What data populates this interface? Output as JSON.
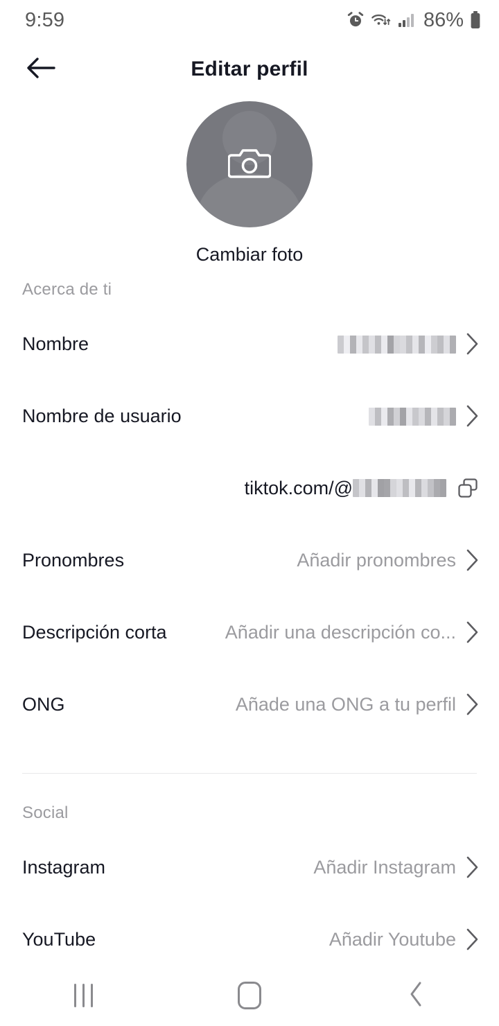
{
  "status_bar": {
    "time": "9:59",
    "battery_percent": "86%",
    "icons": [
      "alarm-icon",
      "wifi-icon",
      "signal-icon",
      "battery-icon"
    ]
  },
  "header": {
    "title": "Editar perfil",
    "back_icon": "arrow-left-icon"
  },
  "avatar": {
    "camera_icon": "camera-icon",
    "change_photo_label": "Cambiar foto",
    "avatar_color": "#77787e"
  },
  "sections": [
    {
      "label": "Acerca de ti",
      "rows": [
        {
          "label": "Nombre",
          "value": "",
          "redacted": true,
          "chevron": true
        },
        {
          "label": "Nombre de usuario",
          "value": "",
          "redacted": true,
          "chevron": true
        },
        {
          "label": "Descripción corta",
          "value": "Añadir una descripción co...",
          "redacted": false,
          "chevron": true
        },
        {
          "label": "Pronombres",
          "value": "Añadir pronombres",
          "redacted": false,
          "chevron": true
        },
        {
          "label": "ONG",
          "value": "Añade una ONG a tu perfil",
          "redacted": false,
          "chevron": true
        }
      ]
    },
    {
      "label": "Social",
      "rows": [
        {
          "label": "Instagram",
          "value": "Añadir Instagram",
          "redacted": false,
          "chevron": true
        },
        {
          "label": "YouTube",
          "value": "Añadir Youtube",
          "redacted": false,
          "chevron": true
        }
      ]
    }
  ],
  "profile_url": {
    "prefix": "tiktok.com/@",
    "handle_redacted": true,
    "copy_icon": "copy-icon"
  },
  "nav_bar": {
    "recents_label": "recents-icon",
    "home_label": "home-icon",
    "back_label": "back-icon"
  },
  "colors": {
    "text_primary": "#161823",
    "text_secondary": "#9b9b9f",
    "divider": "#e8e8e9",
    "background": "#ffffff"
  }
}
